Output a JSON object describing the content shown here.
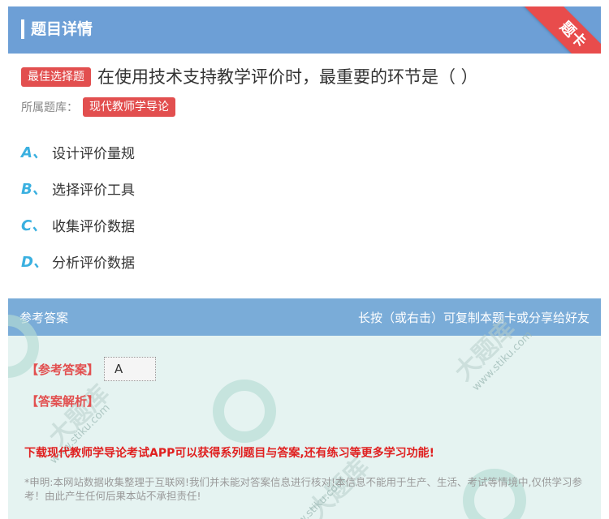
{
  "header": {
    "title": "题目详情",
    "corner_badge": "题卡"
  },
  "question": {
    "type_tag": "最佳选择题",
    "text": "在使用技术支持教学评价时，最重要的环节是（ ）",
    "bank_label": "所属题库：",
    "bank_name": "现代教师学导论"
  },
  "options": [
    {
      "letter": "A、",
      "text": "设计评价量规"
    },
    {
      "letter": "B、",
      "text": "选择评价工具"
    },
    {
      "letter": "C、",
      "text": "收集评价数据"
    },
    {
      "letter": "D、",
      "text": "分析评价数据"
    }
  ],
  "answer_panel": {
    "title": "参考答案",
    "hint": "长按（或右击）可复制本题卡或分享给好友",
    "ref_label": "【参考答案】",
    "ref_value": "A",
    "analysis_label": "【答案解析】",
    "promo": "下载现代教师学导论考试APP可以获得系列题目与答案,还有练习等更多学习功能!",
    "disclaimer": "*申明:本网站数据收集整理于互联网!我们并未能对答案信息进行核对!本信息不能用于生产、生活、考试等情境中,仅供学习参考！由此产生任何后果本站不承担责任!"
  },
  "colors": {
    "header_bg": "#6d9fd6",
    "accent_red": "#e24f4f",
    "option_letter": "#3ab0e0",
    "panel_bg": "#e5f3f1"
  }
}
